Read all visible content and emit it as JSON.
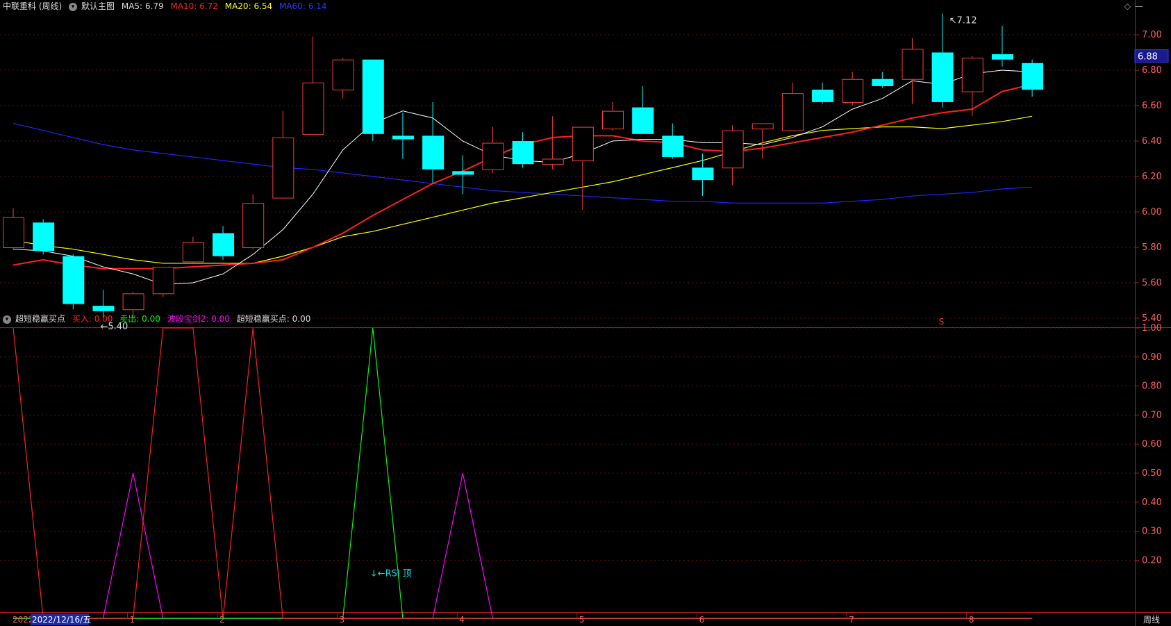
{
  "main_header": {
    "stock": "中联重科 (周线)",
    "chart_name": "默认主图",
    "ma5_label": "MA5:",
    "ma5": "6.79",
    "ma10_label": "MA10:",
    "ma10": "6.72",
    "ma20_label": "MA20:",
    "ma20": "6.54",
    "ma60_label": "MA60:",
    "ma60": "6.14"
  },
  "sub_header": {
    "indicator": "超短稳赢买点",
    "buy_label": "买入:",
    "buy": "0.00",
    "sell_label": "卖出:",
    "sell": "0.00",
    "sword_label": "波段宝剑2:",
    "sword": "0.00",
    "point_label": "超短稳赢买点:",
    "point": "0.00"
  },
  "current_price": "6.88",
  "high_mark": "7.12",
  "low_mark": "5.40",
  "rsi_note": "↓←RSI 顶",
  "marker_s": "S",
  "date_label": "2022/12/16/五",
  "date_prefix": "2022",
  "period_button": "周线",
  "colors": {
    "up": "#ff3c3c",
    "down": "#00ffff",
    "ma5": "#ffffff",
    "ma10": "#ff2020",
    "ma20": "#ffff00",
    "ma60": "#2222ff"
  },
  "chart_data": [
    {
      "type": "candlestick",
      "ylim": [
        5.35,
        7.12
      ],
      "y_ticks": [
        "7.00",
        "6.80",
        "6.60",
        "6.40",
        "6.20",
        "6.00",
        "5.80",
        "5.60",
        "5.40"
      ],
      "candles": [
        {
          "o": 5.8,
          "c": 5.97,
          "h": 6.02,
          "l": 5.79
        },
        {
          "o": 5.94,
          "c": 5.78,
          "h": 5.96,
          "l": 5.76
        },
        {
          "o": 5.75,
          "c": 5.48,
          "h": 5.76,
          "l": 5.45
        },
        {
          "o": 5.47,
          "c": 5.44,
          "h": 5.56,
          "l": 5.4
        },
        {
          "o": 5.45,
          "c": 5.54,
          "h": 5.55,
          "l": 5.4
        },
        {
          "o": 5.54,
          "c": 5.69,
          "h": 5.69,
          "l": 5.52
        },
        {
          "o": 5.72,
          "c": 5.83,
          "h": 5.86,
          "l": 5.71
        },
        {
          "o": 5.88,
          "c": 5.75,
          "h": 5.92,
          "l": 5.73
        },
        {
          "o": 5.8,
          "c": 6.05,
          "h": 6.1,
          "l": 5.79
        },
        {
          "o": 6.08,
          "c": 6.42,
          "h": 6.57,
          "l": 6.08
        },
        {
          "o": 6.44,
          "c": 6.73,
          "h": 6.99,
          "l": 6.44
        },
        {
          "o": 6.69,
          "c": 6.86,
          "h": 6.87,
          "l": 6.64
        },
        {
          "o": 6.86,
          "c": 6.44,
          "h": 6.86,
          "l": 6.4
        },
        {
          "o": 6.43,
          "c": 6.41,
          "h": 6.56,
          "l": 6.3
        },
        {
          "o": 6.43,
          "c": 6.24,
          "h": 6.62,
          "l": 6.16
        },
        {
          "o": 6.23,
          "c": 6.21,
          "h": 6.32,
          "l": 6.1
        },
        {
          "o": 6.24,
          "c": 6.39,
          "h": 6.48,
          "l": 6.22
        },
        {
          "o": 6.4,
          "c": 6.27,
          "h": 6.45,
          "l": 6.25
        },
        {
          "o": 6.27,
          "c": 6.3,
          "h": 6.54,
          "l": 6.24
        },
        {
          "o": 6.29,
          "c": 6.48,
          "h": 6.48,
          "l": 6.01
        },
        {
          "o": 6.47,
          "c": 6.57,
          "h": 6.62,
          "l": 6.46
        },
        {
          "o": 6.59,
          "c": 6.44,
          "h": 6.71,
          "l": 6.44
        },
        {
          "o": 6.43,
          "c": 6.31,
          "h": 6.5,
          "l": 6.3
        },
        {
          "o": 6.25,
          "c": 6.18,
          "h": 6.33,
          "l": 6.09
        },
        {
          "o": 6.25,
          "c": 6.46,
          "h": 6.49,
          "l": 6.15
        },
        {
          "o": 6.47,
          "c": 6.5,
          "h": 6.5,
          "l": 6.3
        },
        {
          "o": 6.46,
          "c": 6.67,
          "h": 6.73,
          "l": 6.46
        },
        {
          "o": 6.69,
          "c": 6.62,
          "h": 6.73,
          "l": 6.61
        },
        {
          "o": 6.62,
          "c": 6.75,
          "h": 6.79,
          "l": 6.6
        },
        {
          "o": 6.75,
          "c": 6.71,
          "h": 6.79,
          "l": 6.7
        },
        {
          "o": 6.75,
          "c": 6.92,
          "h": 6.98,
          "l": 6.61
        },
        {
          "o": 6.9,
          "c": 6.62,
          "h": 7.12,
          "l": 6.59
        },
        {
          "o": 6.68,
          "c": 6.87,
          "h": 6.88,
          "l": 6.54
        },
        {
          "o": 6.89,
          "c": 6.86,
          "h": 7.05,
          "l": 6.82
        },
        {
          "o": 6.84,
          "c": 6.69,
          "h": 6.86,
          "l": 6.65
        }
      ],
      "ma5": [
        5.79,
        5.78,
        5.75,
        5.69,
        5.65,
        5.59,
        5.6,
        5.65,
        5.76,
        5.9,
        6.1,
        6.35,
        6.5,
        6.57,
        6.53,
        6.4,
        6.32,
        6.29,
        6.28,
        6.33,
        6.4,
        6.41,
        6.41,
        6.39,
        6.39,
        6.38,
        6.42,
        6.48,
        6.58,
        6.64,
        6.74,
        6.72,
        6.78,
        6.8,
        6.79
      ],
      "ma10": [
        5.7,
        5.73,
        5.7,
        5.68,
        5.68,
        5.68,
        5.69,
        5.7,
        5.71,
        5.73,
        5.8,
        5.88,
        5.98,
        6.07,
        6.16,
        6.23,
        6.31,
        6.38,
        6.42,
        6.43,
        6.43,
        6.4,
        6.39,
        6.35,
        6.34,
        6.36,
        6.39,
        6.42,
        6.45,
        6.49,
        6.53,
        6.56,
        6.58,
        6.68,
        6.72
      ],
      "ma20": [
        5.84,
        5.81,
        5.79,
        5.76,
        5.73,
        5.71,
        5.71,
        5.71,
        5.71,
        5.75,
        5.8,
        5.86,
        5.89,
        5.93,
        5.97,
        6.01,
        6.05,
        6.08,
        6.11,
        6.14,
        6.17,
        6.21,
        6.25,
        6.29,
        6.34,
        6.39,
        6.43,
        6.46,
        6.47,
        6.48,
        6.48,
        6.47,
        6.49,
        6.51,
        6.54
      ],
      "ma60": [
        6.5,
        6.46,
        6.42,
        6.38,
        6.35,
        6.33,
        6.31,
        6.29,
        6.27,
        6.25,
        6.24,
        6.22,
        6.2,
        6.18,
        6.16,
        6.14,
        6.12,
        6.11,
        6.1,
        6.09,
        6.08,
        6.07,
        6.06,
        6.06,
        6.05,
        6.05,
        6.05,
        6.05,
        6.06,
        6.07,
        6.09,
        6.1,
        6.11,
        6.13,
        6.14
      ]
    },
    {
      "type": "line",
      "ylim": [
        0,
        1.0
      ],
      "y_ticks": [
        "1.00",
        "0.90",
        "0.80",
        "0.70",
        "0.60",
        "0.50",
        "0.40",
        "0.30",
        "0.20"
      ],
      "x_ticks": [
        "1",
        "2",
        "3",
        "4",
        "5",
        "6",
        "7",
        "8"
      ],
      "series": [
        {
          "name": "买入",
          "color": "#ff2020",
          "values": [
            1,
            0,
            0,
            0,
            0,
            1,
            1,
            0,
            1,
            0,
            0,
            0,
            0,
            0,
            0,
            0,
            0,
            0,
            0,
            0,
            0,
            0,
            0,
            0,
            0,
            0,
            0,
            0,
            0,
            0,
            0,
            0,
            0,
            0,
            0
          ]
        },
        {
          "name": "卖出",
          "color": "#00ff00",
          "values": [
            0,
            0,
            0,
            0,
            0,
            0,
            0,
            0,
            0,
            0,
            0,
            0,
            1,
            0,
            0,
            0,
            0,
            0,
            0,
            0,
            0,
            0,
            0,
            0,
            0,
            0,
            0,
            0,
            0,
            0,
            0,
            0,
            0,
            0,
            0
          ]
        },
        {
          "name": "波段宝剑2",
          "color": "#ff00ff",
          "values": [
            0,
            0,
            0,
            0,
            0.5,
            0,
            0,
            0,
            0,
            0,
            0,
            0,
            0,
            0,
            0,
            0.5,
            0,
            0,
            0,
            0,
            0,
            0,
            0,
            0,
            0,
            0,
            0,
            0,
            0,
            0,
            0,
            0,
            0,
            0,
            0
          ]
        },
        {
          "name": "超短稳赢买点",
          "color": "#ffffff",
          "values": [
            0,
            0,
            0,
            0,
            0,
            0,
            0,
            0,
            0,
            0,
            0,
            0,
            0,
            0,
            0,
            0,
            0,
            0,
            0,
            0,
            0,
            0,
            0,
            0,
            0,
            0,
            0,
            0,
            0,
            0,
            0,
            0,
            0,
            0,
            0
          ]
        }
      ]
    }
  ]
}
